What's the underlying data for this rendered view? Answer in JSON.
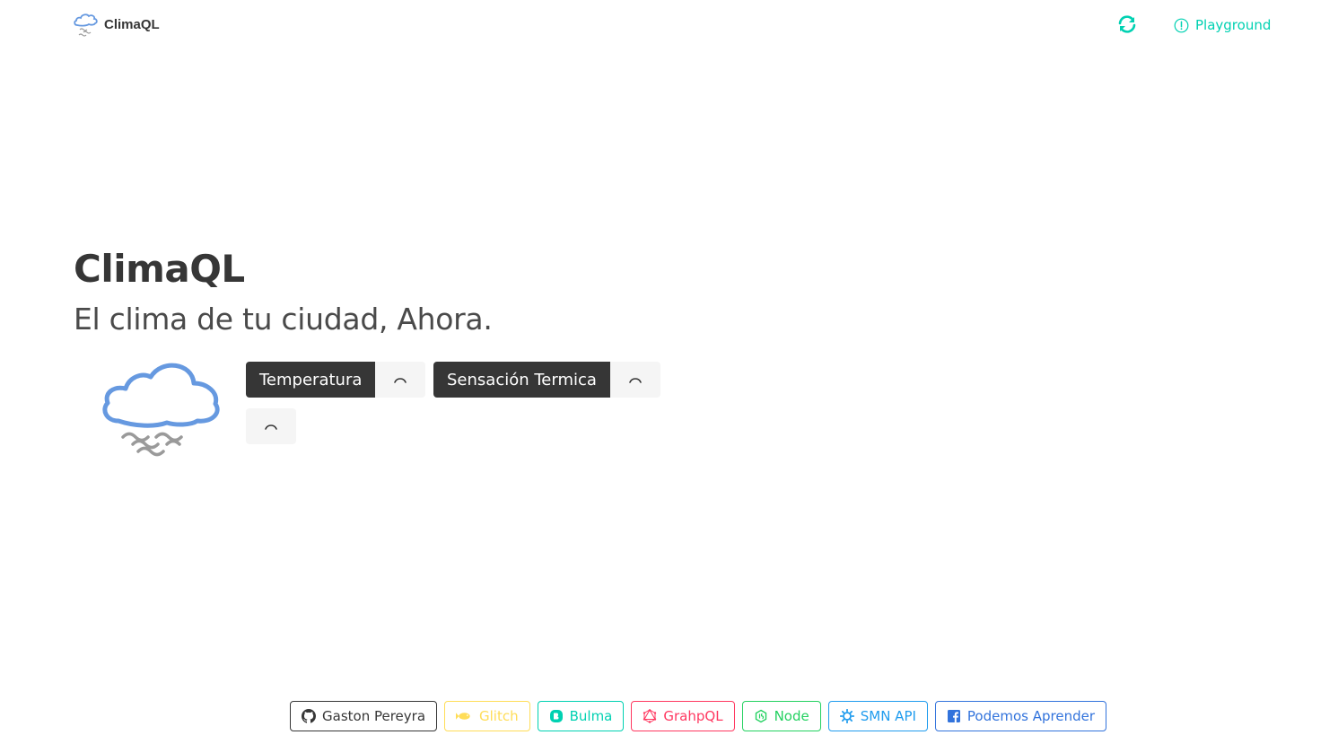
{
  "colors": {
    "primary": "#00d1b2",
    "dark": "#363636",
    "light": "#f5f5f5",
    "cloud_blue": "#6699e0",
    "fog_gray": "#999999"
  },
  "navbar": {
    "brand": "ClimaQL",
    "brand_icon": "cloud-fog-icon",
    "refresh_icon": "refresh-icon",
    "playground_icon": "info-circle-icon",
    "playground_label": "Playground"
  },
  "hero": {
    "title": "ClimaQL",
    "subtitle": "El clima de tu ciudad, Ahora.",
    "weather_icon": "fog-cloud-icon"
  },
  "weather": {
    "temperature_label": "Temperatura",
    "feels_like_label": "Sensación Termica",
    "loading_icon": "loading-spinner-icon"
  },
  "footer": {
    "links": [
      {
        "label": "Gaston Pereyra",
        "icon": "github-icon",
        "color": "#363636"
      },
      {
        "label": "Glitch",
        "icon": "fish-icon",
        "color": "#ffdd57"
      },
      {
        "label": "Bulma",
        "icon": "bulma-icon",
        "color": "#00d1b2"
      },
      {
        "label": "GrahpQL",
        "icon": "graphql-icon",
        "color": "#ff3860"
      },
      {
        "label": "Node",
        "icon": "node-js-icon",
        "color": "#23d160"
      },
      {
        "label": "SMN API",
        "icon": "sun-icon",
        "color": "#209cee"
      },
      {
        "label": "Podemos Aprender",
        "icon": "facebook-icon",
        "color": "#3273dc"
      }
    ]
  }
}
